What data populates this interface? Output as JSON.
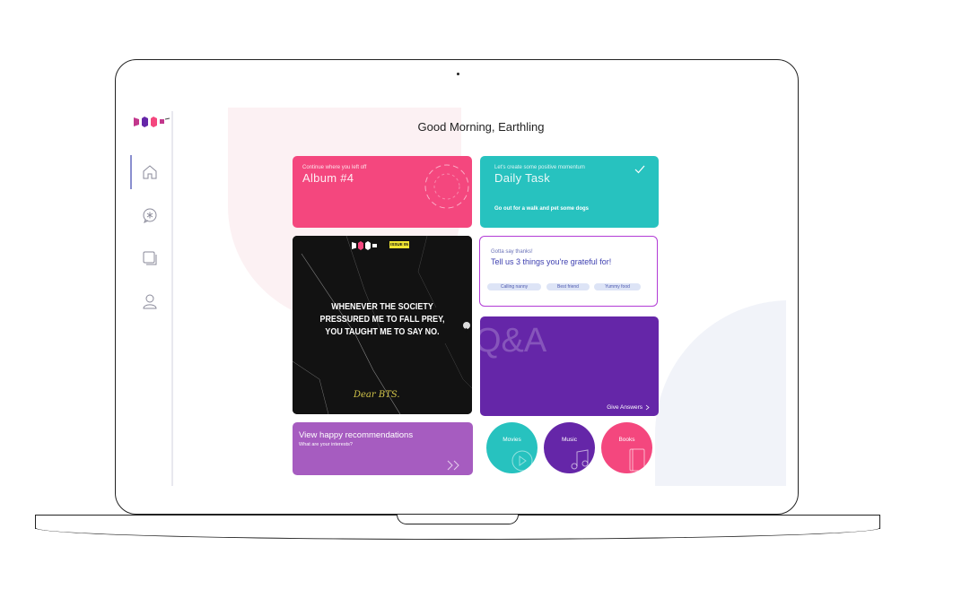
{
  "header": {
    "greeting": "Good Morning, Earthling"
  },
  "sidebar": {
    "items": [
      {
        "name": "home",
        "icon": "home-icon",
        "active": true
      },
      {
        "name": "chat",
        "icon": "chat-bubble-icon",
        "active": false
      },
      {
        "name": "library",
        "icon": "stack-icon",
        "active": false
      },
      {
        "name": "profile",
        "icon": "user-icon",
        "active": false
      }
    ]
  },
  "cards": {
    "album": {
      "label": "Continue where you left off",
      "title": "Album #4",
      "color": "#f4477e"
    },
    "daily_task": {
      "label": "Let's create some positive momentum",
      "title": "Daily Task",
      "body": "Go out for a walk and pet some dogs",
      "color": "#27c2bf"
    },
    "quote": {
      "badge": "ISSUE 05",
      "lines": [
        "WHENEVER THE SOCIETY",
        "PRESSURED ME TO FALL PREY,",
        "YOU TAUGHT ME TO SAY NO."
      ],
      "signature": "Dear BTS."
    },
    "thanks": {
      "label": "Gotta say thanks!",
      "title": "Tell us 3 things you're grateful for!",
      "chips": [
        "Calling nanny",
        "Best friend",
        "Yummy food"
      ]
    },
    "qa": {
      "title": "Q&A",
      "link": "Give Answers",
      "color": "#6526a8"
    },
    "recommendations": {
      "title": "View happy recommendations",
      "subtitle": "What are your interests?",
      "color": "#a65cc0"
    }
  },
  "categories": [
    {
      "label": "Movies",
      "color": "#27c2bf",
      "icon": "play-icon"
    },
    {
      "label": "Music",
      "color": "#6526a8",
      "icon": "music-note-icon"
    },
    {
      "label": "Books",
      "color": "#f4477e",
      "icon": "book-icon"
    }
  ],
  "colors": {
    "accent_pink": "#f4477e",
    "accent_teal": "#27c2bf",
    "accent_purple": "#6526a8",
    "accent_violet": "#a65cc0"
  }
}
